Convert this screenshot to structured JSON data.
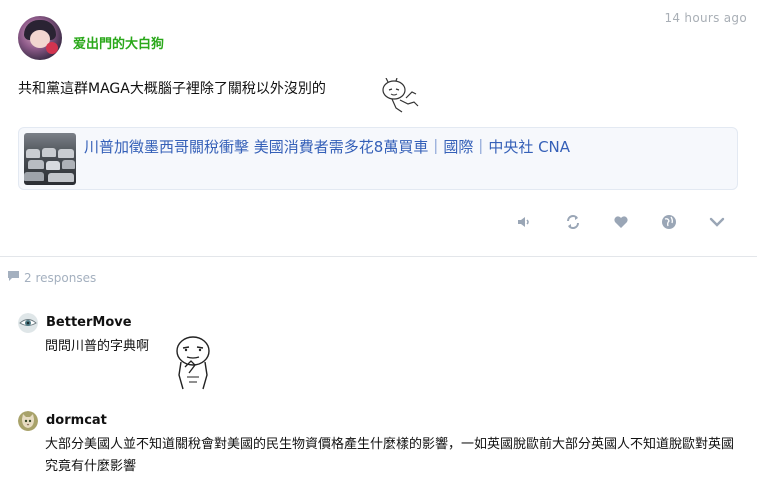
{
  "post": {
    "author": "爱出門的大白狗",
    "timestamp": "14 hours ago",
    "text": "共和黨這群MAGA大概腦子裡除了關稅以外沒別的",
    "avatar_icon": "anime-avatar",
    "sticker_icon": "bunny-sticker"
  },
  "link_card": {
    "title": "川普加徵墨西哥關稅衝擊 美國消費者需多花8萬買車｜國際｜中央社 CNA",
    "thumbnail_icon": "parked-cars-thumbnail"
  },
  "actions": [
    {
      "name": "speaker-icon"
    },
    {
      "name": "repost-icon"
    },
    {
      "name": "heart-icon"
    },
    {
      "name": "globe-icon"
    },
    {
      "name": "chevron-down-icon"
    }
  ],
  "responses": {
    "label": "2 responses",
    "icon": "comment-bubble-icon"
  },
  "comments": [
    {
      "author": "BetterMove",
      "text": "問問川普的字典啊",
      "avatar_icon": "eye-avatar",
      "sticker_icon": "thinking-face-sticker"
    },
    {
      "author": "dormcat",
      "text": "大部分美國人並不知道關稅會對美國的民生物資價格產生什麼樣的影響，一如英國脫歐前大部分英國人不知道脫歐對英國究竟有什麼影響",
      "avatar_icon": "cat-avatar"
    }
  ],
  "colors": {
    "author_green": "#2aa81a",
    "link_blue": "#3560b8",
    "muted_gray": "#a9afb6",
    "icon_gray": "#9aa6b6"
  }
}
